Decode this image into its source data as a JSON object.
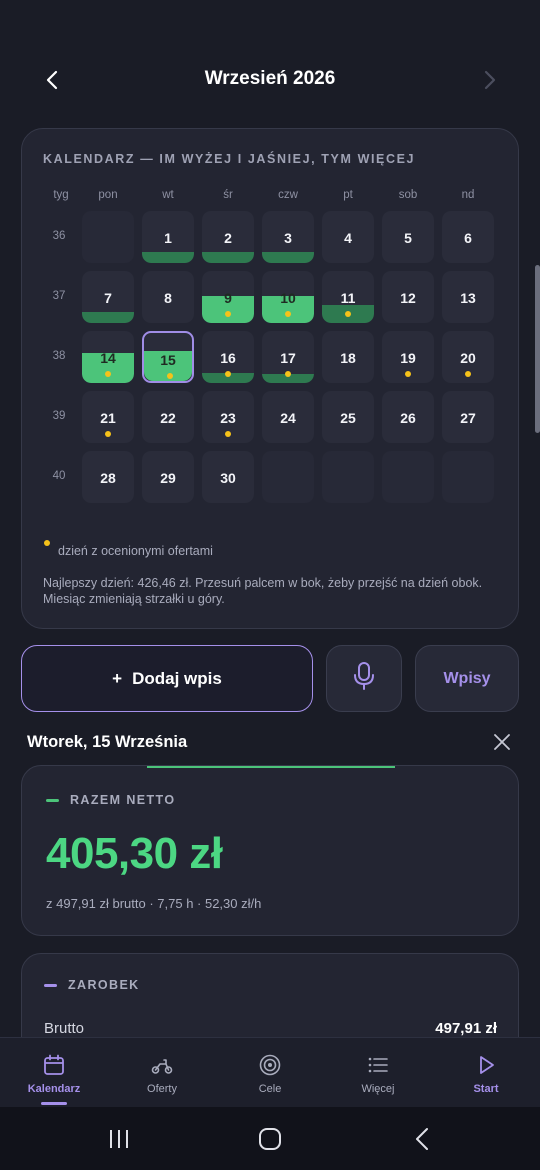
{
  "header": {
    "title": "Wrzesień 2026",
    "prev_icon": "chevron-left-icon",
    "next_icon": "chevron-right-icon"
  },
  "calendar": {
    "heading": "KALENDARZ — IM WYŻEJ I JAŚNIEJ, TYM WIĘCEJ",
    "week_col_label": "tyg",
    "weekdays": [
      "pon",
      "wt",
      "śr",
      "czw",
      "pt",
      "sob",
      "nd"
    ],
    "week_numbers": [
      "36",
      "37",
      "38",
      "39",
      "40"
    ],
    "days": [
      {
        "d": "1",
        "fill": 0.22,
        "bright": false,
        "dot": false
      },
      {
        "d": "2",
        "fill": 0.22,
        "bright": false,
        "dot": false
      },
      {
        "d": "3",
        "fill": 0.22,
        "bright": false,
        "dot": false
      },
      {
        "d": "4",
        "fill": 0,
        "bright": false,
        "dot": false
      },
      {
        "d": "5",
        "fill": 0,
        "bright": false,
        "dot": false
      },
      {
        "d": "6",
        "fill": 0,
        "bright": false,
        "dot": false
      },
      {
        "d": "7",
        "fill": 0.22,
        "bright": false,
        "dot": false
      },
      {
        "d": "8",
        "fill": 0,
        "bright": false,
        "dot": false
      },
      {
        "d": "9",
        "fill": 0.52,
        "bright": true,
        "dot": true
      },
      {
        "d": "10",
        "fill": 0.52,
        "bright": true,
        "dot": true
      },
      {
        "d": "11",
        "fill": 0.34,
        "bright": false,
        "dot": true
      },
      {
        "d": "12",
        "fill": 0,
        "bright": false,
        "dot": false
      },
      {
        "d": "13",
        "fill": 0,
        "bright": false,
        "dot": false
      },
      {
        "d": "14",
        "fill": 0.58,
        "bright": true,
        "dot": true
      },
      {
        "d": "15",
        "fill": 0.58,
        "bright": true,
        "dot": true,
        "selected": true
      },
      {
        "d": "16",
        "fill": 0.2,
        "bright": false,
        "dot": true
      },
      {
        "d": "17",
        "fill": 0.18,
        "bright": false,
        "dot": true
      },
      {
        "d": "18",
        "fill": 0,
        "bright": false,
        "dot": false
      },
      {
        "d": "19",
        "fill": 0,
        "bright": false,
        "dot": true
      },
      {
        "d": "20",
        "fill": 0,
        "bright": false,
        "dot": true
      },
      {
        "d": "21",
        "fill": 0,
        "bright": false,
        "dot": true
      },
      {
        "d": "22",
        "fill": 0,
        "bright": false,
        "dot": false
      },
      {
        "d": "23",
        "fill": 0,
        "bright": false,
        "dot": true
      },
      {
        "d": "24",
        "fill": 0,
        "bright": false,
        "dot": false
      },
      {
        "d": "25",
        "fill": 0,
        "bright": false,
        "dot": false
      },
      {
        "d": "26",
        "fill": 0,
        "bright": false,
        "dot": false
      },
      {
        "d": "27",
        "fill": 0,
        "bright": false,
        "dot": false
      },
      {
        "d": "28",
        "fill": 0,
        "bright": false,
        "dot": false
      },
      {
        "d": "29",
        "fill": 0,
        "bright": false,
        "dot": false
      },
      {
        "d": "30",
        "fill": 0,
        "bright": false,
        "dot": false
      }
    ],
    "legend": "dzień z ocenionymi ofertami",
    "best_day_text": "Najlepszy dzień: 426,46 zł. Przesuń palcem w bok, żeby przejść na dzień obok. Miesiąc zmieniają strzałki u góry."
  },
  "actions": {
    "add_label": "Dodaj wpis",
    "add_plus": "+",
    "mic_icon": "microphone-icon",
    "entries_label": "Wpisy"
  },
  "day": {
    "title": "Wtorek, 15 Września",
    "net_label": "RAZEM NETTO",
    "net_value": "405,30 zł",
    "net_sub": "z 497,91 zł brutto · 7,75 h · 52,30 zł/h",
    "earn_label": "ZAROBEK",
    "gross_label": "Brutto",
    "gross_value": "497,91 zł"
  },
  "nav": [
    {
      "label": "Kalendarz",
      "icon": "calendar-icon",
      "active": true
    },
    {
      "label": "Oferty",
      "icon": "scooter-icon"
    },
    {
      "label": "Cele",
      "icon": "target-icon"
    },
    {
      "label": "Więcej",
      "icon": "list-icon"
    },
    {
      "label": "Start",
      "icon": "play-icon"
    }
  ],
  "colors": {
    "accent": "#a590ea",
    "green": "#4cd783",
    "dot": "#f5c21a",
    "background": "#1a1c26"
  }
}
